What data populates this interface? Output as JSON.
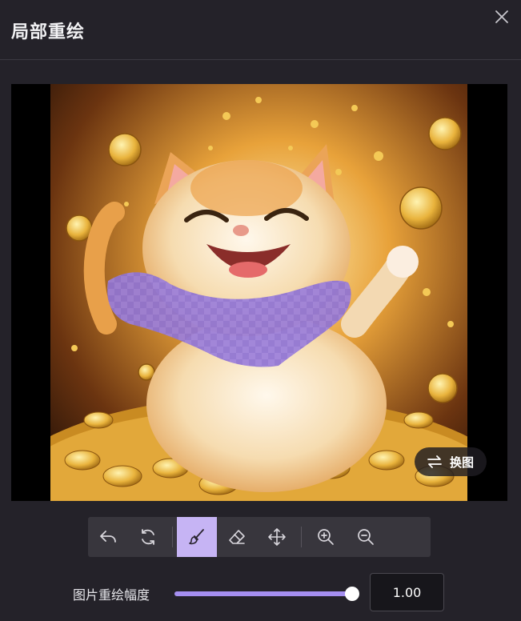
{
  "dialog": {
    "title": "局部重绘",
    "close_icon": "close-icon"
  },
  "canvas": {
    "image_description_hidden": "",
    "mask_color": "#9b7fdc",
    "swap_button": {
      "label": "换图",
      "icon": "swap-arrows-icon"
    }
  },
  "toolbar": {
    "tools": [
      {
        "name": "undo",
        "icon": "undo-icon",
        "active": false
      },
      {
        "name": "redo",
        "icon": "redo-icon",
        "active": false
      },
      {
        "name": "brush",
        "icon": "brush-icon",
        "active": true
      },
      {
        "name": "eraser",
        "icon": "eraser-icon",
        "active": false
      },
      {
        "name": "move",
        "icon": "move-icon",
        "active": false
      },
      {
        "name": "zoom-in",
        "icon": "zoom-in-icon",
        "active": false
      },
      {
        "name": "zoom-out",
        "icon": "zoom-out-icon",
        "active": false
      }
    ],
    "active_color": "#c6b4f4"
  },
  "strength": {
    "label": "图片重绘幅度",
    "value": "1.00",
    "fraction": 1.0,
    "accent": "#a58ff0"
  }
}
